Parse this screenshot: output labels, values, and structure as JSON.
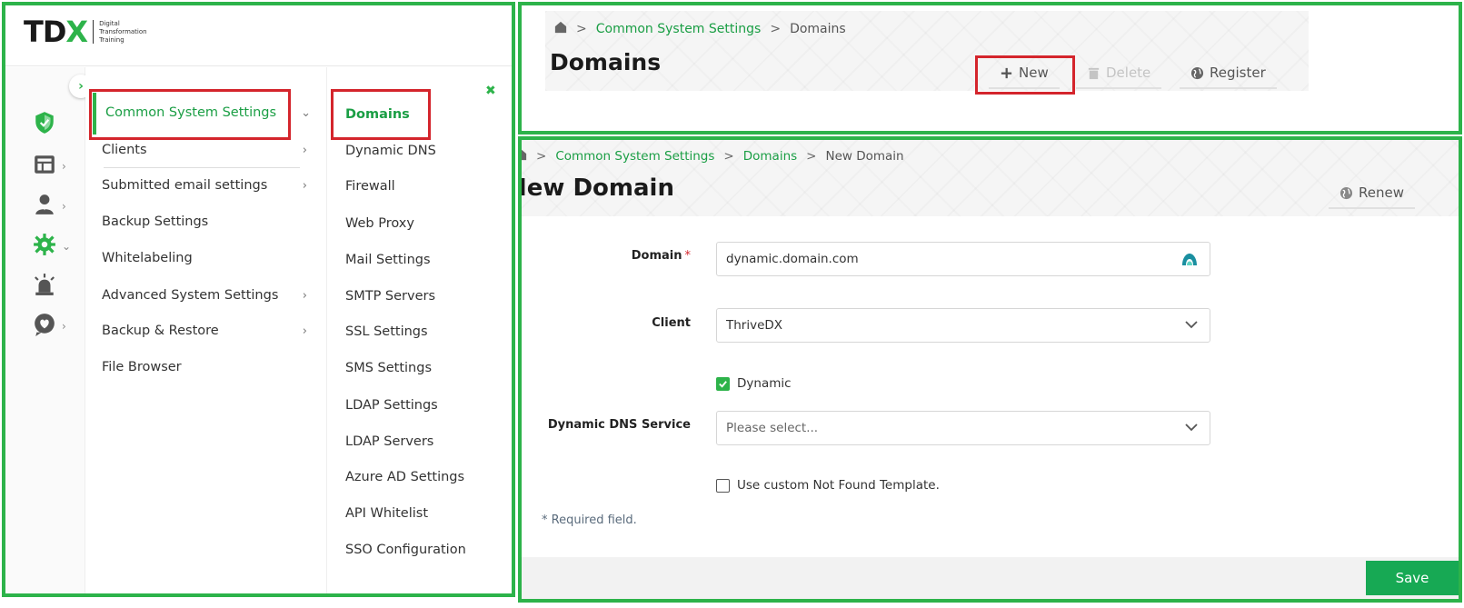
{
  "logo": {
    "mark_left": "TD",
    "mark_right": "X",
    "sub_line1": "Digital",
    "sub_line2": "Transformation",
    "sub_line3": "Training"
  },
  "menu": {
    "items": [
      {
        "label": "Common System Settings",
        "chevron": "⌄"
      },
      {
        "label": "Clients",
        "chevron": "›"
      },
      {
        "label": "Submitted email settings",
        "chevron": "›"
      },
      {
        "label": "Backup Settings",
        "chevron": ""
      },
      {
        "label": "Whitelabeling",
        "chevron": ""
      },
      {
        "label": "Advanced System Settings",
        "chevron": "›"
      },
      {
        "label": "Backup & Restore",
        "chevron": "›"
      },
      {
        "label": "File Browser",
        "chevron": ""
      }
    ]
  },
  "submenu": {
    "items": [
      "Domains",
      "Dynamic DNS",
      "Firewall",
      "Web Proxy",
      "Mail Settings",
      "SMTP Servers",
      "SSL Settings",
      "SMS Settings",
      "LDAP Settings",
      "LDAP Servers",
      "Azure AD Settings",
      "API Whitelist",
      "SSO Configuration"
    ]
  },
  "rail": {
    "icons": [
      "shield-icon",
      "dashboard-icon",
      "user-icon",
      "gear-icon",
      "alarm-icon",
      "heart-chat-icon"
    ]
  },
  "top": {
    "breadcrumb": {
      "sep": ">",
      "link": "Common System Settings",
      "current": "Domains"
    },
    "title": "Domains",
    "toolbar": {
      "new": "New",
      "delete": "Delete",
      "register": "Register"
    }
  },
  "bottom": {
    "breadcrumb": {
      "sep": ">",
      "link1": "Common System Settings",
      "link2": "Domains",
      "current": "New Domain"
    },
    "title": "New Domain",
    "renew": "Renew",
    "form": {
      "domain_label": "Domain",
      "required_mark": "*",
      "domain_value": "dynamic.domain.com",
      "client_label": "Client",
      "client_value": "ThriveDX",
      "dynamic_label": "Dynamic",
      "dynamic_checked": true,
      "dns_label": "Dynamic DNS Service",
      "dns_placeholder": "Please select...",
      "custom_template_label": "Use custom Not Found Template.",
      "custom_template_checked": false,
      "required_note": "* Required field."
    },
    "save": "Save"
  },
  "colors": {
    "accent": "#2db34a",
    "link": "#1a9e44",
    "highlight_box": "#d4252c",
    "save": "#17a954"
  }
}
